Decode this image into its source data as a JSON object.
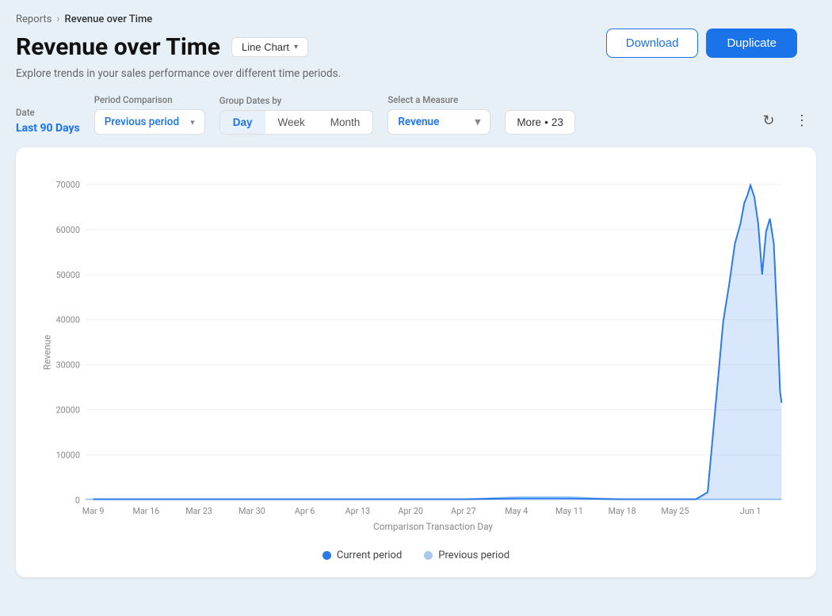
{
  "breadcrumb": {
    "parent": "Reports",
    "current": "Revenue over Time"
  },
  "page": {
    "title": "Revenue over Time",
    "subtitle": "Explore trends in your sales performance over different time periods.",
    "chart_type_label": "Line Chart"
  },
  "header_buttons": {
    "download": "Download",
    "duplicate": "Duplicate"
  },
  "filters": {
    "date": {
      "label": "Date",
      "value": "Last 90 Days"
    },
    "period_comparison": {
      "label": "Period Comparison",
      "value": "Previous period"
    },
    "group_dates": {
      "label": "Group Dates by",
      "options": [
        "Day",
        "Week",
        "Month"
      ],
      "active": "Day"
    },
    "measure": {
      "label": "Select a Measure",
      "value": "Revenue"
    },
    "more": {
      "label": "More",
      "count": "23"
    }
  },
  "chart": {
    "y_axis_label": "Revenue",
    "x_axis_label": "Comparison Transaction Day",
    "y_ticks": [
      "0",
      "10000",
      "20000",
      "30000",
      "40000",
      "50000",
      "60000",
      "70000"
    ],
    "x_ticks": [
      "Mar 9",
      "Mar 16",
      "Mar 23",
      "Mar 30",
      "Apr 6",
      "Apr 13",
      "Apr 20",
      "Apr 27",
      "May 4",
      "May 11",
      "May 18",
      "May 25",
      "Jun 1"
    ],
    "legend": {
      "current": "Current period",
      "previous": "Previous period"
    }
  },
  "icons": {
    "refresh": "↻",
    "more_vert": "⋮",
    "chevron_down": "▾"
  }
}
